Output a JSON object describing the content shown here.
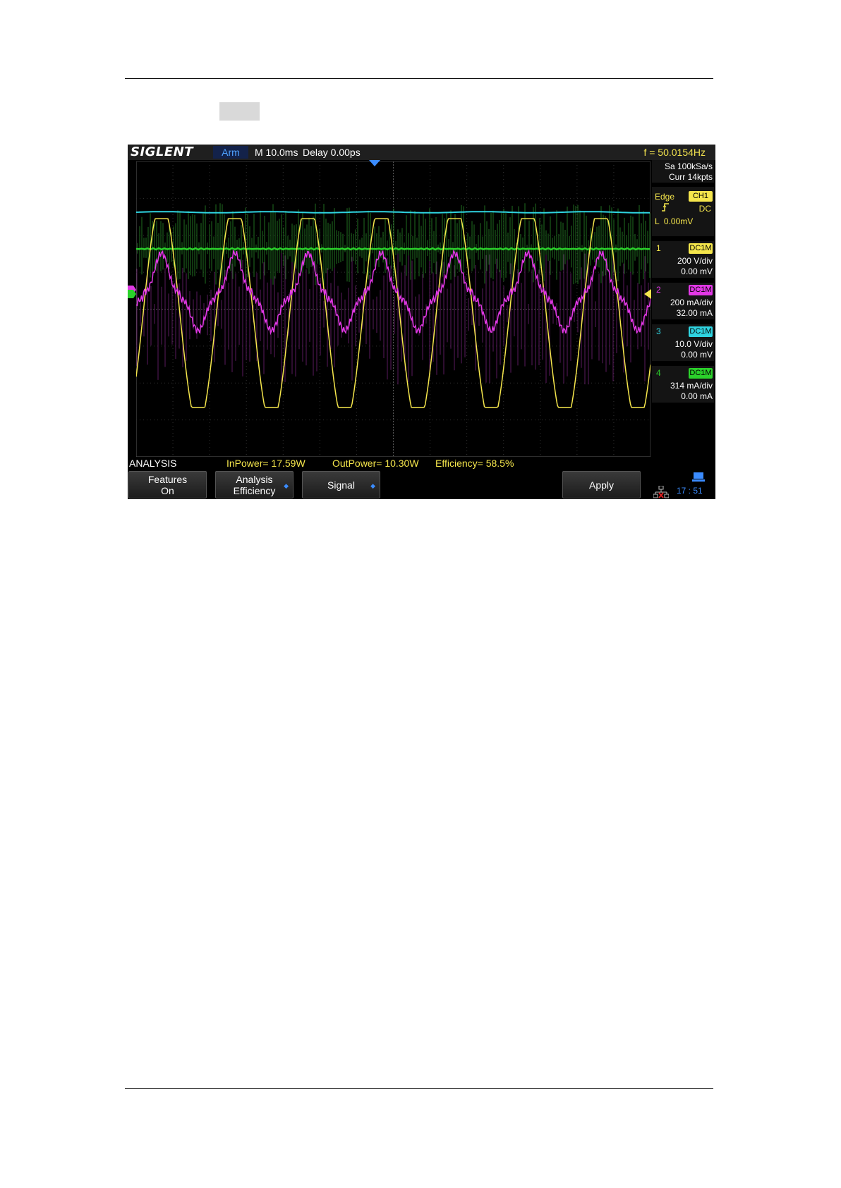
{
  "scope": {
    "brand": "SIGLENT",
    "top_bar": {
      "mode": "Arm",
      "timebase": "M 10.0ms",
      "delay": "Delay 0.00ps",
      "frequency": "f = 50.0154Hz"
    },
    "acquisition": {
      "sample_rate": "Sa 100kSa/s",
      "memory": "Curr 14kpts"
    },
    "trigger": {
      "type": "Edge",
      "source": "CH1",
      "coupling": "DC",
      "level": "L  0.00mV"
    },
    "channels": [
      {
        "num": "1",
        "coupling": "DC1M",
        "scale": "200 V/div",
        "offset": "0.00 mV",
        "color": "#f5e64c"
      },
      {
        "num": "2",
        "coupling": "DC1M",
        "scale": "200 mA/div",
        "offset": "32.00 mA",
        "color": "#e238e6"
      },
      {
        "num": "3",
        "coupling": "DC1M",
        "scale": "10.0 V/div",
        "offset": "0.00 mV",
        "color": "#2fd3e0"
      },
      {
        "num": "4",
        "coupling": "DC1M",
        "scale": "314 mA/div",
        "offset": "0.00 mA",
        "color": "#2bd12b"
      }
    ],
    "status": {
      "label": "ANALYSIS",
      "in_power": "InPower= 17.59W",
      "out_power": "OutPower= 10.30W",
      "efficiency": "Efficiency= 58.5%"
    },
    "menu": {
      "features_line1": "Features",
      "features_line2": "On",
      "analysis_line1": "Analysis",
      "analysis_line2": "Efficiency",
      "signal": "Signal",
      "apply": "Apply"
    },
    "clock": "17 : 51",
    "colors": {
      "ch1": "#f5e64c",
      "ch2": "#e238e6",
      "ch3": "#2fd3e0",
      "ch4": "#2bd12b",
      "accent": "#3b8cff"
    }
  }
}
